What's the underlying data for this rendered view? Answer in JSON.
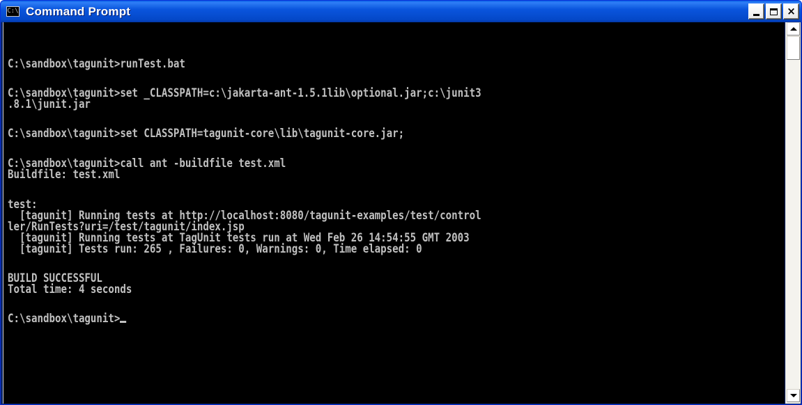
{
  "window": {
    "title": "Command Prompt",
    "icon_text": "C:\\",
    "buttons": {
      "minimize": "_",
      "maximize": "□",
      "close": "×"
    }
  },
  "console": {
    "colors": {
      "background": "#000000",
      "text": "#c0c0c0"
    },
    "lines": [
      "C:\\sandbox\\tagunit>runTest.bat",
      "C:\\sandbox\\tagunit>set _CLASSPATH=c:\\jakarta-ant-1.5.1lib\\optional.jar;c:\\junit3",
      ".8.1\\junit.jar",
      "C:\\sandbox\\tagunit>set CLASSPATH=tagunit-core\\lib\\tagunit-core.jar;",
      "C:\\sandbox\\tagunit>call ant -buildfile test.xml",
      "Buildfile: test.xml",
      "test:",
      "  [tagunit] Running tests at http://localhost:8080/tagunit-examples/test/control",
      "ler/RunTests?uri=/test/tagunit/index.jsp",
      "  [tagunit] Running tests at TagUnit tests run at Wed Feb 26 14:54:55 GMT 2003",
      "  [tagunit] Tests run: 265 , Failures: 0, Warnings: 0, Time elapsed: 0",
      "BUILD SUCCESSFUL",
      "Total time: 4 seconds",
      "C:\\sandbox\\tagunit>"
    ]
  },
  "scrollbar": {
    "up_icon": "scroll-up-arrow",
    "down_icon": "scroll-down-arrow"
  }
}
